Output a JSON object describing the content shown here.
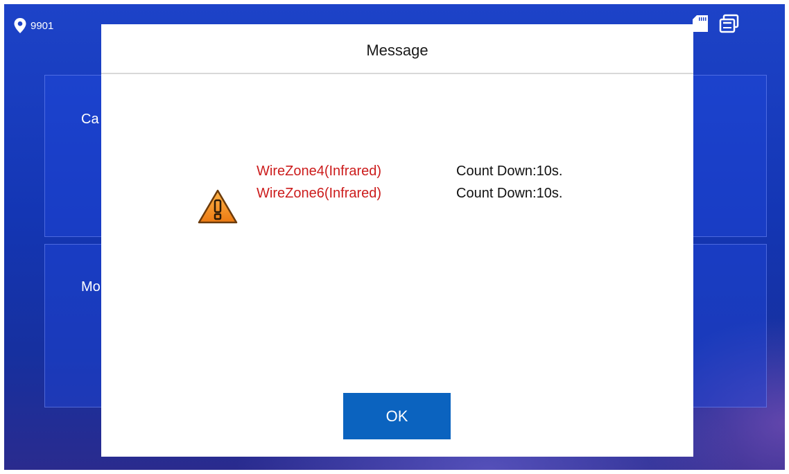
{
  "status_bar": {
    "room_number": "9901",
    "location_icon": "location-pin-icon",
    "sd_card_icon": "sd-card-icon",
    "display_icon": "screen-icon"
  },
  "background_cards": [
    {
      "label": "Ca"
    },
    {
      "label": "Mo"
    }
  ],
  "dialog": {
    "title": "Message",
    "icon": "warning-icon",
    "alarms": [
      {
        "zone": "WireZone4(Infrared)",
        "countdown": "Count Down:10s."
      },
      {
        "zone": "WireZone6(Infrared)",
        "countdown": "Count Down:10s."
      }
    ],
    "ok_label": "OK"
  },
  "colors": {
    "background_blue": "#1a3ec4",
    "zone_text_red": "#cc1c1c",
    "ok_button_blue": "#0b63bf",
    "warning_orange": "#f08a1c"
  }
}
